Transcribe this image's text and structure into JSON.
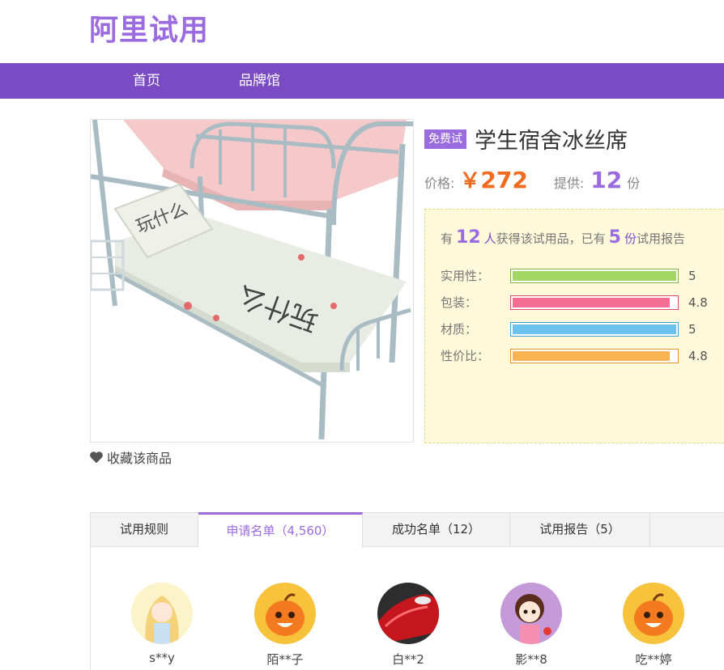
{
  "header": {
    "logo": "阿里试用"
  },
  "nav": {
    "items": [
      "首页",
      "品牌馆"
    ]
  },
  "product": {
    "badge": "免费试",
    "title": "学生宿舍冰丝席",
    "price_label": "价格:",
    "price_symbol": "￥",
    "price": "272",
    "supply_label": "提供:",
    "supply_count": "12",
    "supply_unit": "份",
    "favorite_label": "收藏该商品",
    "image_colors": {
      "frame": "#a9bcc3",
      "top_mat": "#f5c9c9",
      "bottom_mat": "#e9ece4"
    }
  },
  "report": {
    "prefix": "有",
    "winners_count": "12",
    "winners_unit": "人",
    "middle": "获得该试用品，已有",
    "reports_count": "5",
    "reports_unit": "份",
    "suffix": "试用报告",
    "ratings": [
      {
        "label": "实用性：",
        "value": "5",
        "score": 5,
        "max": 5,
        "color": "#a3d663",
        "border": "#7fb33f"
      },
      {
        "label": "包装：",
        "value": "4.8",
        "score": 4.8,
        "max": 5,
        "color": "#f46d95",
        "border": "#d94a75"
      },
      {
        "label": "材质：",
        "value": "5",
        "score": 5,
        "max": 5,
        "color": "#6cc4ee",
        "border": "#3fa3d4"
      },
      {
        "label": "性价比：",
        "value": "4.8",
        "score": 4.8,
        "max": 5,
        "color": "#fbb253",
        "border": "#e69430"
      }
    ]
  },
  "tabs": {
    "rules": "试用规则",
    "applicants": "申请名单（4,560）",
    "winners": "成功名单（12）",
    "reports": "试用报告（5）"
  },
  "applicants": [
    {
      "name": "s**y",
      "avatar": "anime-girl-icon"
    },
    {
      "name": "陌**子",
      "avatar": "orange-mascot-icon"
    },
    {
      "name": "白**2",
      "avatar": "red-car-icon"
    },
    {
      "name": "影**8",
      "avatar": "doll-girl-icon"
    },
    {
      "name": "吃**婷",
      "avatar": "orange-mascot-icon"
    }
  ]
}
